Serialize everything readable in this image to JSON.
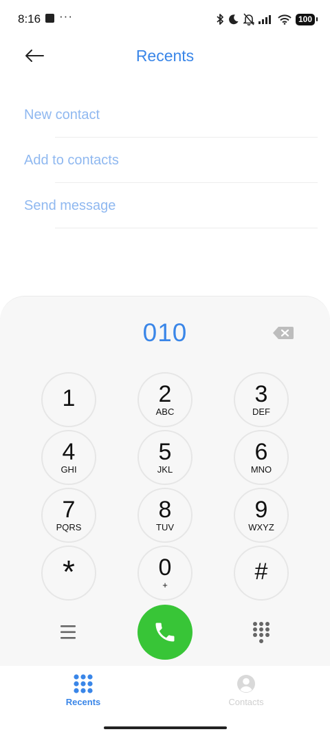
{
  "status_bar": {
    "time": "8:16",
    "overflow": "···",
    "battery": "100",
    "icons": [
      "bluetooth-icon",
      "moon-icon",
      "bell-off-icon",
      "signal-icon",
      "wifi-icon",
      "battery-icon"
    ]
  },
  "header": {
    "title": "Recents",
    "back_icon": "arrow-left-icon"
  },
  "options": [
    {
      "label": "New contact"
    },
    {
      "label": "Add to contacts"
    },
    {
      "label": "Send message"
    }
  ],
  "dialer": {
    "number": "010",
    "keys": [
      {
        "digit": "1",
        "letters": ""
      },
      {
        "digit": "2",
        "letters": "ABC"
      },
      {
        "digit": "3",
        "letters": "DEF"
      },
      {
        "digit": "4",
        "letters": "GHI"
      },
      {
        "digit": "5",
        "letters": "JKL"
      },
      {
        "digit": "6",
        "letters": "MNO"
      },
      {
        "digit": "7",
        "letters": "PQRS"
      },
      {
        "digit": "8",
        "letters": "TUV"
      },
      {
        "digit": "9",
        "letters": "WXYZ"
      },
      {
        "digit": "*",
        "letters": ""
      },
      {
        "digit": "0",
        "letters": "+"
      },
      {
        "digit": "#",
        "letters": ""
      }
    ],
    "call_color": "#38c537"
  },
  "bottom_nav": {
    "tabs": [
      {
        "label": "Recents",
        "active": true,
        "icon": "keypad-grid-icon"
      },
      {
        "label": "Contacts",
        "active": false,
        "icon": "person-icon"
      }
    ]
  },
  "colors": {
    "accent": "#3a86e8",
    "option_text": "#8fb8f0",
    "call_green": "#38c537"
  }
}
